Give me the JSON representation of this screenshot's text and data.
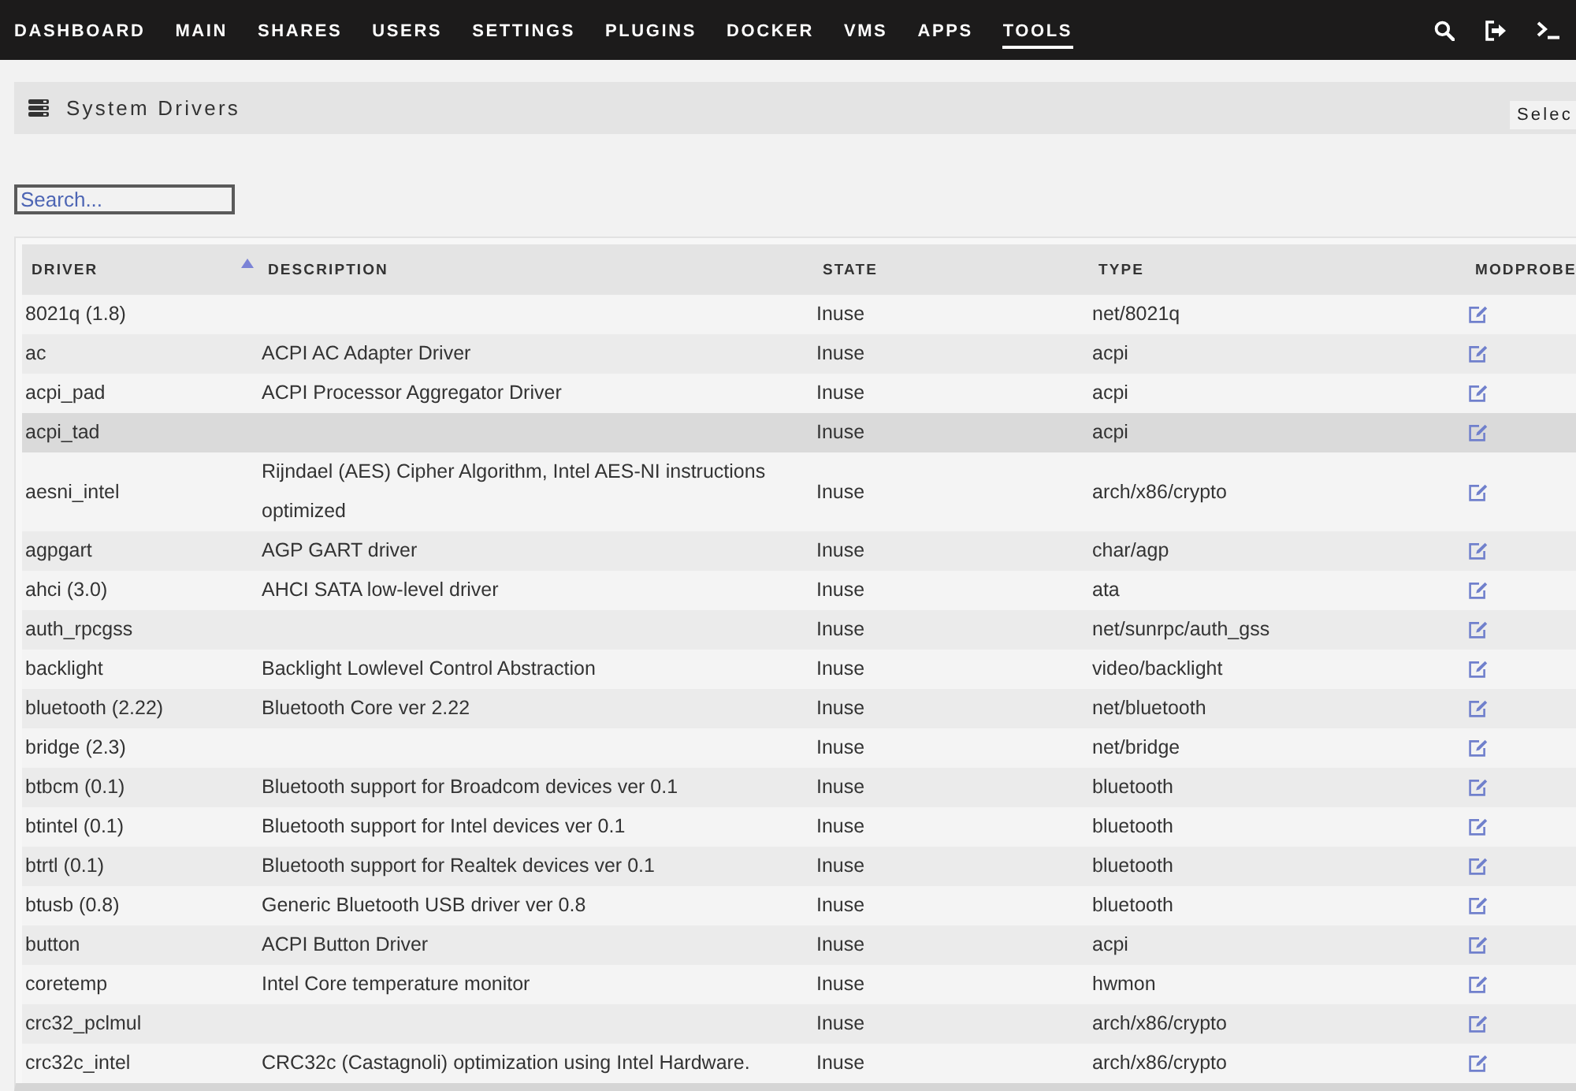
{
  "top_nav": {
    "items": [
      {
        "label": "DASHBOARD",
        "selected": false
      },
      {
        "label": "MAIN",
        "selected": false
      },
      {
        "label": "SHARES",
        "selected": false
      },
      {
        "label": "USERS",
        "selected": false
      },
      {
        "label": "SETTINGS",
        "selected": false
      },
      {
        "label": "PLUGINS",
        "selected": false
      },
      {
        "label": "DOCKER",
        "selected": false
      },
      {
        "label": "VMS",
        "selected": false
      },
      {
        "label": "APPS",
        "selected": false
      },
      {
        "label": "TOOLS",
        "selected": true
      }
    ]
  },
  "page_header": {
    "title": "System Drivers",
    "selector": {
      "text": "Selec"
    }
  },
  "search": {
    "placeholder": "Search..."
  },
  "table": {
    "columns": [
      {
        "label": "DRIVER",
        "sorted": true
      },
      {
        "label": "DESCRIPTION",
        "sorted": false
      },
      {
        "label": "STATE",
        "sorted": false
      },
      {
        "label": "TYPE",
        "sorted": false
      },
      {
        "label": "MODPROBE",
        "sorted": false
      }
    ],
    "rows": [
      {
        "driver": "8021q (1.8)",
        "state": "Inuse",
        "type": "net/8021q",
        "selected": false
      },
      {
        "driver": "ac",
        "description": "ACPI AC Adapter Driver",
        "state": "Inuse",
        "type": "acpi",
        "selected": false
      },
      {
        "driver": "acpi_pad",
        "description": "ACPI Processor Aggregator Driver",
        "state": "Inuse",
        "type": "acpi",
        "selected": false
      },
      {
        "driver": "acpi_tad",
        "state": "Inuse",
        "type": "acpi",
        "selected": true
      },
      {
        "driver": "aesni_intel",
        "description": "Rijndael (AES) Cipher Algorithm, Intel AES-NI instructions optimized",
        "state": "Inuse",
        "type": "arch/x86/crypto",
        "selected": false
      },
      {
        "driver": "agpgart",
        "description": "AGP GART driver",
        "state": "Inuse",
        "type": "char/agp",
        "selected": false
      },
      {
        "driver": "ahci (3.0)",
        "description": "AHCI SATA low-level driver",
        "state": "Inuse",
        "type": "ata",
        "selected": false
      },
      {
        "driver": "auth_rpcgss",
        "state": "Inuse",
        "type": "net/sunrpc/auth_gss",
        "selected": false
      },
      {
        "driver": "backlight",
        "description": "Backlight Lowlevel Control Abstraction",
        "state": "Inuse",
        "type": "video/backlight",
        "selected": false
      },
      {
        "driver": "bluetooth (2.22)",
        "description": "Bluetooth Core ver 2.22",
        "state": "Inuse",
        "type": "net/bluetooth",
        "selected": false
      },
      {
        "driver": "bridge (2.3)",
        "state": "Inuse",
        "type": "net/bridge",
        "selected": false
      },
      {
        "driver": "btbcm (0.1)",
        "description": "Bluetooth support for Broadcom devices ver 0.1",
        "state": "Inuse",
        "type": "bluetooth",
        "selected": false
      },
      {
        "driver": "btintel (0.1)",
        "description": "Bluetooth support for Intel devices ver 0.1",
        "state": "Inuse",
        "type": "bluetooth",
        "selected": false
      },
      {
        "driver": "btrtl (0.1)",
        "description": "Bluetooth support for Realtek devices ver 0.1",
        "state": "Inuse",
        "type": "bluetooth",
        "selected": false
      },
      {
        "driver": "btusb (0.8)",
        "description": "Generic Bluetooth USB driver ver 0.8",
        "state": "Inuse",
        "type": "bluetooth",
        "selected": false
      },
      {
        "driver": "button",
        "description": "ACPI Button Driver",
        "state": "Inuse",
        "type": "acpi",
        "selected": false
      },
      {
        "driver": "coretemp",
        "description": "Intel Core temperature monitor",
        "state": "Inuse",
        "type": "hwmon",
        "selected": false
      },
      {
        "driver": "crc32_pclmul",
        "state": "Inuse",
        "type": "arch/x86/crypto",
        "selected": false
      },
      {
        "driver": "crc32c_intel",
        "description": "CRC32c (Castagnoli) optimization using Intel Hardware.",
        "state": "Inuse",
        "type": "arch/x86/crypto",
        "selected": false
      }
    ]
  }
}
